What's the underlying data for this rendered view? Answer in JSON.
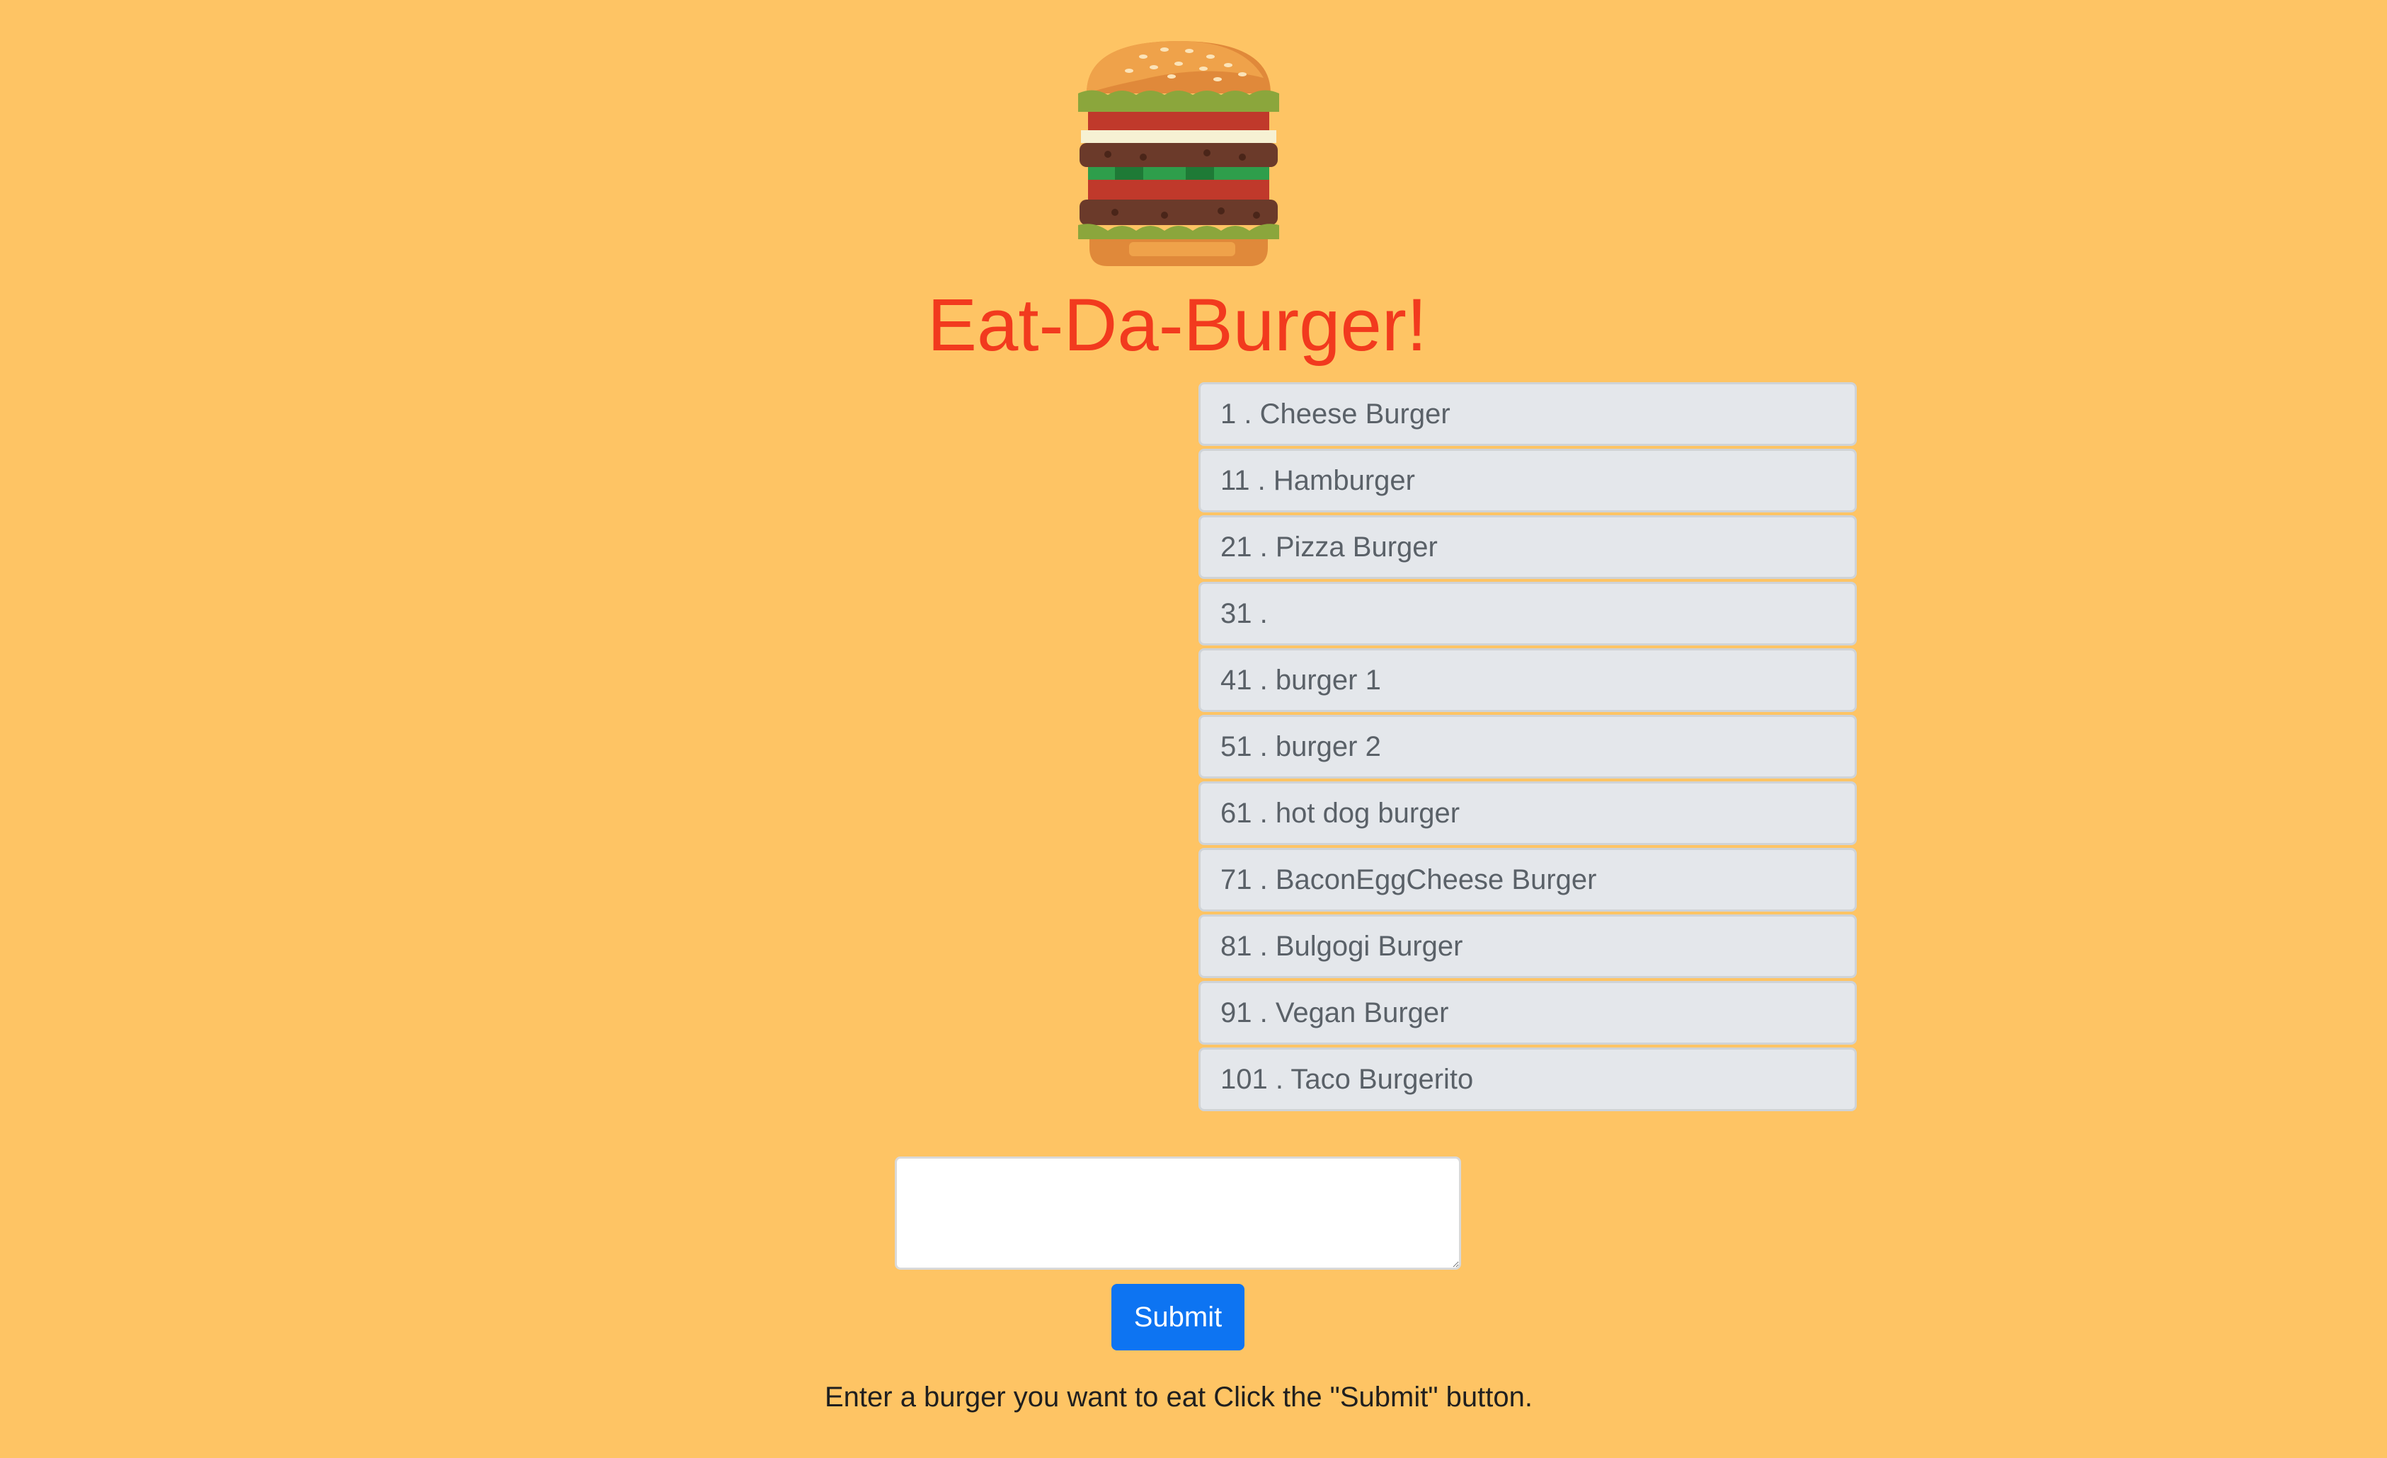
{
  "app": {
    "title": "Eat-Da-Burger!",
    "logo_icon": "burger-icon"
  },
  "burgers": [
    {
      "id": "1",
      "name": "Cheese Burger"
    },
    {
      "id": "11",
      "name": "Hamburger"
    },
    {
      "id": "21",
      "name": "Pizza Burger"
    },
    {
      "id": "31",
      "name": ""
    },
    {
      "id": "41",
      "name": "burger 1"
    },
    {
      "id": "51",
      "name": "burger 2"
    },
    {
      "id": "61",
      "name": "hot dog burger"
    },
    {
      "id": "71",
      "name": "BaconEggCheese Burger"
    },
    {
      "id": "81",
      "name": "Bulgogi Burger"
    },
    {
      "id": "91",
      "name": "Vegan Burger"
    },
    {
      "id": "101",
      "name": "Taco Burgerito"
    }
  ],
  "form": {
    "input_value": "",
    "input_placeholder": "",
    "submit_label": "Submit"
  },
  "instructions": "Enter a burger you want to eat Click the \"Submit\" button.",
  "colors": {
    "background": "#FEC464",
    "title": "#F23A1E",
    "list_item_bg": "#E4E7EB",
    "list_item_text": "#5A6168",
    "button": "#0D74F2"
  }
}
